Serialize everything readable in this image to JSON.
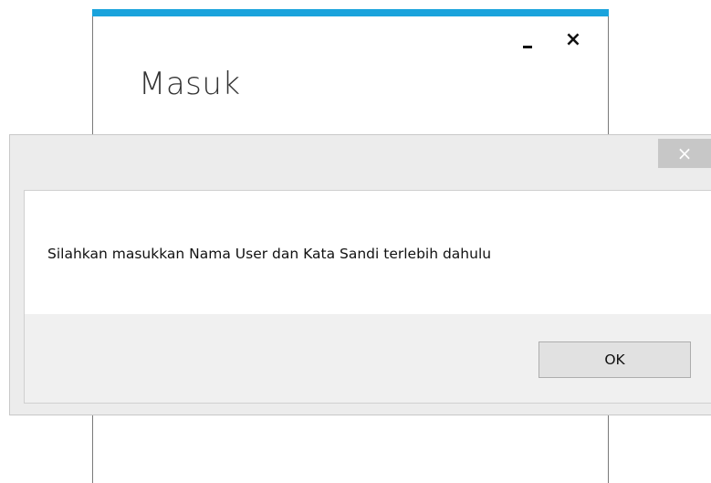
{
  "login_window": {
    "title": "Masuk",
    "minimize_glyph": "",
    "close_glyph": "×",
    "accent_color": "#1aa3dc"
  },
  "dialog": {
    "close_glyph": "×",
    "message": "Silahkan masukkan Nama User dan Kata Sandi terlebih dahulu",
    "ok_label": "OK"
  }
}
